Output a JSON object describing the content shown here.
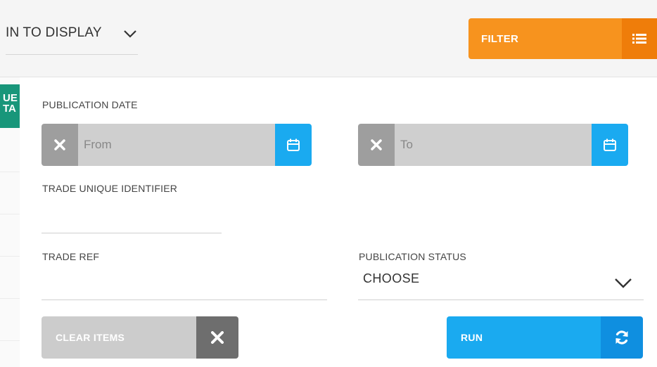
{
  "header": {
    "column_select_label": "IN TO DISPLAY",
    "filter_label": "FILTER"
  },
  "side_tag": {
    "line1": "UE",
    "line2": "TA"
  },
  "form": {
    "publication_date_label": "PUBLICATION DATE",
    "from_placeholder": "From",
    "to_placeholder": "To",
    "trade_uid_label": "TRADE UNIQUE IDENTIFIER",
    "trade_ref_label": "TRADE REF",
    "publication_status_label": "PUBLICATION STATUS",
    "publication_status_value": "CHOOSE"
  },
  "actions": {
    "clear_label": "CLEAR ITEMS",
    "run_label": "RUN"
  },
  "colors": {
    "filter": "#f7931e",
    "primary": "#1aaaf0",
    "teal": "#18967a",
    "grey_dark": "#6e6e6e"
  },
  "icons": {
    "column_select": "chevron-down-icon",
    "filter": "list-icon",
    "date_clear": "close-icon",
    "date_picker": "calendar-icon",
    "status_select": "chevron-down-icon",
    "clear": "close-icon",
    "run": "refresh-icon"
  }
}
